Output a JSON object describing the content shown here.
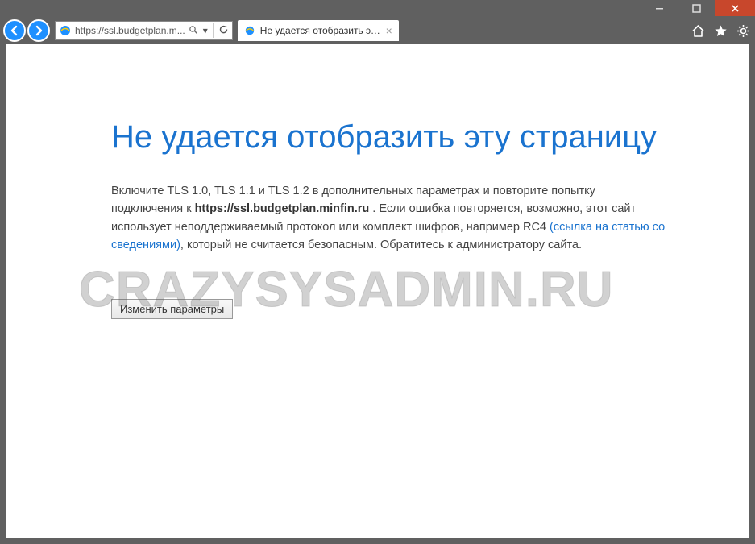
{
  "window": {
    "minimize": "–",
    "maximize": "□",
    "close": "✕"
  },
  "address": {
    "url_display": "https://ssl.budgetplan.m...",
    "search_glyph": "🔍",
    "dropdown_glyph": "▾",
    "refresh_glyph": "↻"
  },
  "tab": {
    "title": "Не удается отобразить эту...",
    "close_glyph": "×"
  },
  "toolbar_icons": {
    "home": "⌂",
    "favorites": "★",
    "tools": "⚙"
  },
  "page": {
    "title": "Не удается отобразить эту страницу",
    "body_part1": "Включите TLS 1.0, TLS 1.1 и TLS 1.2 в дополнительных параметрах и повторите попытку подключения к ",
    "body_bold": "https://ssl.budgetplan.minfin.ru",
    "body_part2": " . Если ошибка повторяется, возможно, этот сайт использует неподдерживаемый протокол или комплект шифров, например RC4 ",
    "link_text": "(ссылка на статью со сведениями)",
    "body_part3": ", который не считается безопасным. Обратитесь к администратору сайта.",
    "button_label": "Изменить параметры"
  },
  "watermark": "CRAZYSYSADMIN.RU"
}
